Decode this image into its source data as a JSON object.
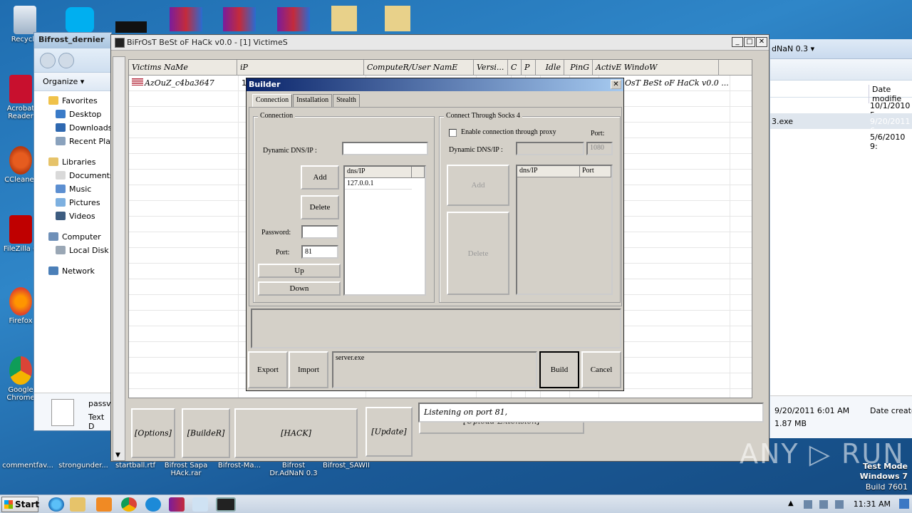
{
  "desktop": {
    "icons_left": [
      "Recycle",
      "Acrobat Reader",
      "CCleaner",
      "FileZilla C",
      "Firefox",
      "Google Chrome"
    ],
    "bottom_labels": [
      "commentfav...",
      "strongunder...",
      "startball.rtf",
      "Bifrost Sapa HAck.rar",
      "Bifrost-Ma...",
      "Bifrost Dr.AdNaN 0.3",
      "Bifrost_SAWII"
    ]
  },
  "explorer": {
    "title": "Bifrost_dernier",
    "organize": "Organize",
    "nav": [
      "Favorites",
      "Desktop",
      "Downloads",
      "Recent Plac",
      "Libraries",
      "Documents",
      "Music",
      "Pictures",
      "Videos",
      "Computer",
      "Local Disk (C",
      "Network"
    ],
    "file_name": "passv",
    "file_type": "Text D"
  },
  "right_explorer": {
    "path": "dNaN 0.3",
    "col_date": "Date modifie",
    "rows": [
      {
        "name": "",
        "date": "10/1/2010 5"
      },
      {
        "name": "3.exe",
        "date": "9/20/2011 6"
      },
      {
        "name": "",
        "date": "5/6/2010 9:"
      }
    ],
    "detail_date": "9/20/2011 6:01 AM",
    "detail_created": "Date created",
    "detail_size": "1.87 MB"
  },
  "bifrost": {
    "title": "BiFrOsT BeSt oF HaCk v0.0   - [1] VictimeS",
    "columns": [
      "Victims NaMe",
      "iP",
      "ComputeR/User NamE",
      "Versi...",
      "C",
      "P",
      "Idle",
      "PinG",
      "ActivE WindoW"
    ],
    "victim": {
      "name": "AzOuZ_c4ba3647",
      "ip": "1",
      "window": "OsT BeSt oF HaCk v0.0 ..."
    },
    "buttons": {
      "options": "[Options]",
      "builder": "[BuildeR]",
      "hack": "[HACK]",
      "update": "[Update]",
      "upload": "[Upload Extension]"
    },
    "status": "Listening on port 81,"
  },
  "builder": {
    "title": "Builder",
    "tabs": [
      "Connection",
      "Installation",
      "Stealth"
    ],
    "connection_group": "Connection",
    "dns_label": "Dynamic DNS/IP :",
    "dns_value": "",
    "add": "Add",
    "delete": "Delete",
    "password_label": "Password:",
    "password_value": "",
    "port_label": "Port:",
    "port_value": "81",
    "up": "Up",
    "down": "Down",
    "list_header": "dns/IP",
    "list_items": [
      "127.0.0.1"
    ],
    "socks_group": "Connect Through Socks 4",
    "proxy_checkbox": "Enable connection through proxy",
    "socks_port_label": "Port:",
    "socks_port_value": "1080",
    "socks_dns_label": "Dynamic DNS/IP :",
    "socks_add": "Add",
    "socks_delete": "Delete",
    "socks_col_dns": "dns/IP",
    "socks_col_port": "Port",
    "export": "Export",
    "import": "Import",
    "output_file": "server.exe",
    "build": "Build",
    "cancel": "Cancel"
  },
  "taskbar": {
    "start": "Start",
    "time": "11:31 AM"
  },
  "watermark": {
    "text": "ANY ▷ RUN",
    "test_mode": "Test Mode",
    "os": "Windows 7",
    "build": "Build 7601"
  }
}
